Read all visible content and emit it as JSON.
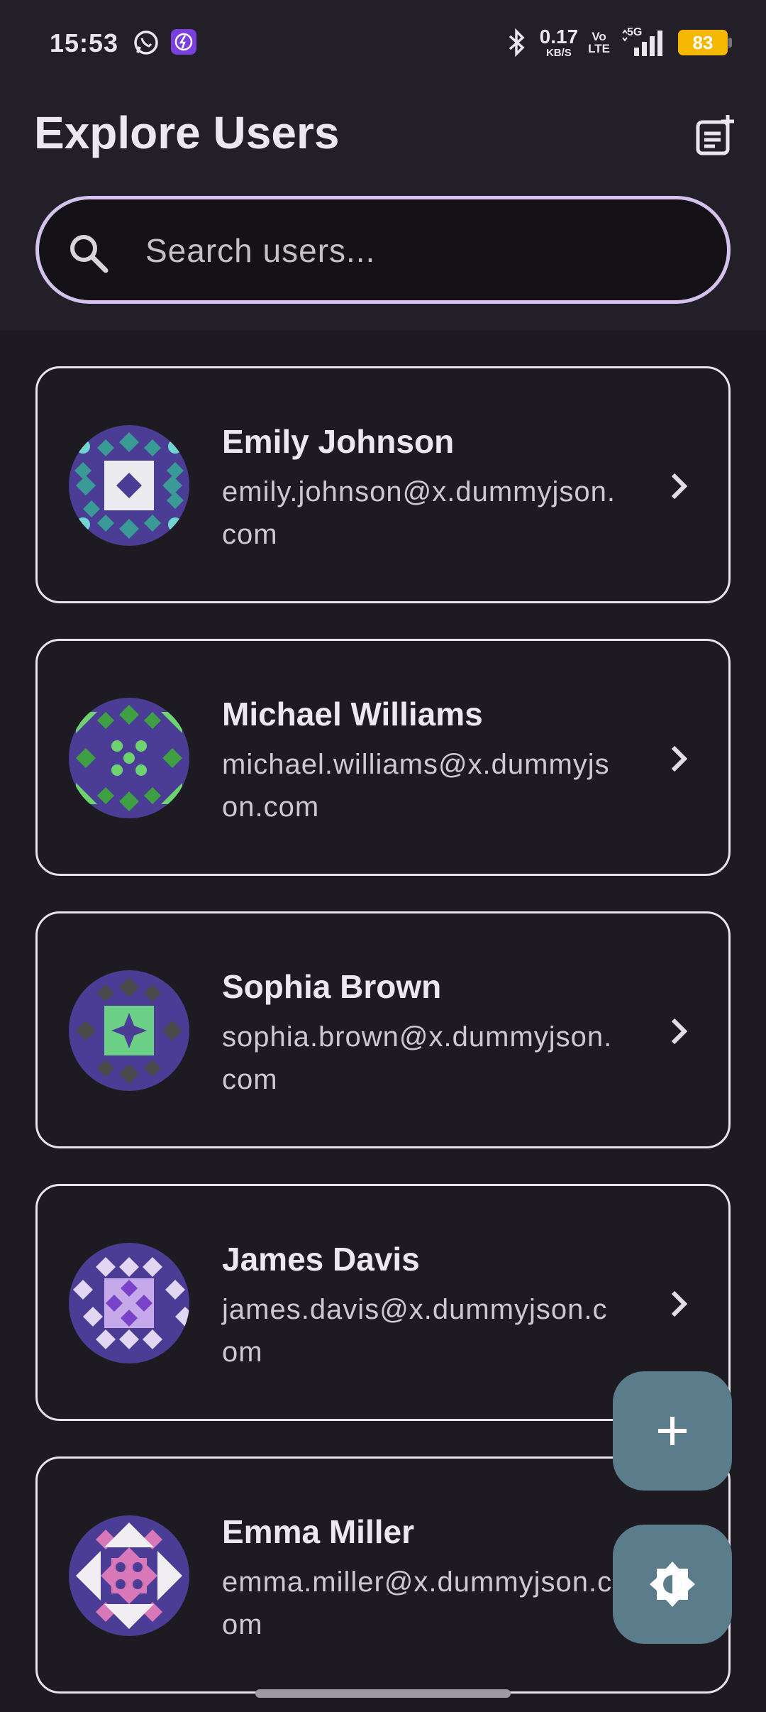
{
  "status_bar": {
    "time": "15:53",
    "net_speed_value": "0.17",
    "net_speed_unit": "KB/S",
    "volte_top": "Vo",
    "volte_bottom": "LTE",
    "network": "5G",
    "battery": "83"
  },
  "header": {
    "title": "Explore Users"
  },
  "search": {
    "placeholder": "Search users...",
    "value": ""
  },
  "users": [
    {
      "name": "Emily Johnson",
      "email": "emily.johnson@x.dummyjson.com"
    },
    {
      "name": "Michael Williams",
      "email": "michael.williams@x.dummyjson.com"
    },
    {
      "name": "Sophia Brown",
      "email": "sophia.brown@x.dummyjson.com"
    },
    {
      "name": "James Davis",
      "email": "james.davis@x.dummyjson.com"
    },
    {
      "name": "Emma Miller",
      "email": "emma.miller@x.dummyjson.com"
    }
  ],
  "icons": {
    "header_action": "add-note-icon",
    "search": "search-icon",
    "chevron": "chevron-right-icon",
    "fab_add": "plus-icon",
    "fab_theme": "brightness-icon"
  },
  "colors": {
    "background": "#1d1b21",
    "header_background": "#221f28",
    "search_border": "#d6c2ef",
    "fab": "#5b7c8b",
    "battery": "#f5b800"
  }
}
